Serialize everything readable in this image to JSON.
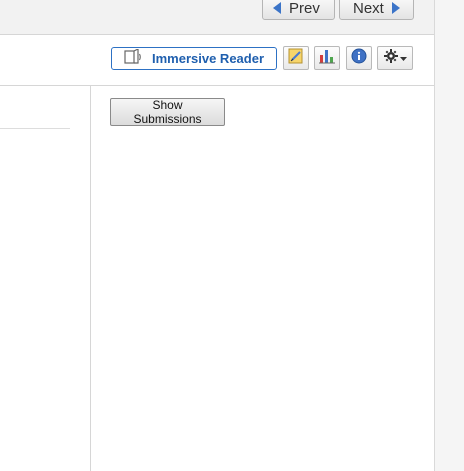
{
  "navigation": {
    "prev_label": "Prev",
    "next_label": "Next"
  },
  "toolbar": {
    "immersive_reader_label": "Immersive Reader",
    "icons": [
      "immersive-reader-icon",
      "edit-icon",
      "bar-chart-icon",
      "info-icon",
      "gear-icon",
      "caret-down-icon"
    ]
  },
  "content": {
    "show_submissions_label": "Show Submissions"
  },
  "colors": {
    "accent": "#2d71c4",
    "nav_arrow": "#3b74c8",
    "toolbar_bg": "#f2f2f2"
  }
}
